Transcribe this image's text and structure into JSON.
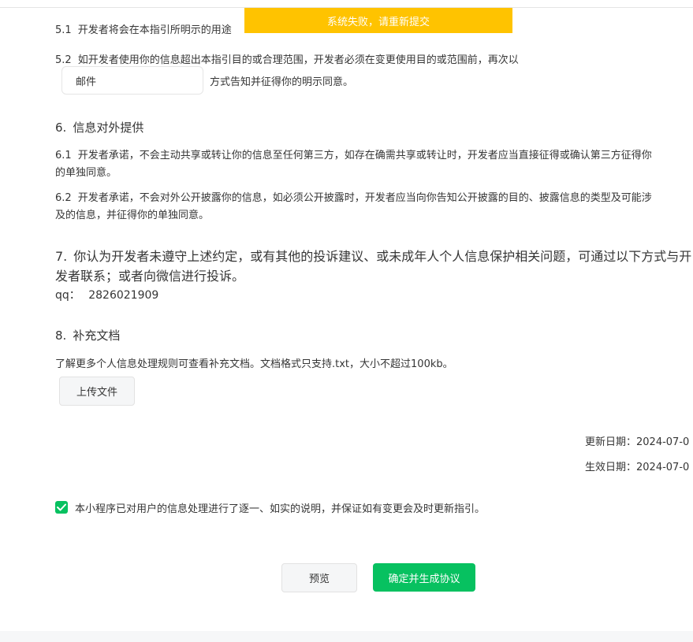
{
  "toast": {
    "text": "系统失败，请重新提交"
  },
  "section5": {
    "item1": {
      "num": "5.1",
      "text": "开发者将会在本指引所明示的用途"
    },
    "item2": {
      "num": "5.2",
      "text": "如开发者使用你的信息超出本指引目的或合理范围，开发者必须在变更使用目的或范围前，再次以"
    },
    "method_input_value": "邮件",
    "method_suffix": "方式告知并征得你的明示同意。"
  },
  "section6": {
    "heading_num": "6.",
    "heading": "信息对外提供",
    "item1": {
      "num": "6.1",
      "line1": "开发者承诺，不会主动共享或转让你的信息至任何第三方，如存在确需共享或转让时，开发者应当直接征得或确认第三方征得你",
      "line2": "的单独同意。"
    },
    "item2": {
      "num": "6.2",
      "line1": "开发者承诺，不会对外公开披露你的信息，如必须公开披露时，开发者应当向你告知公开披露的目的、披露信息的类型及可能涉",
      "line2": "及的信息，并征得你的单独同意。"
    }
  },
  "section7": {
    "heading_num": "7.",
    "line1": "你认为开发者未遵守上述约定，或有其他的投诉建议、或未成年人个人信息保护相关问题，可通过以下方式与开",
    "line2": "发者联系；或者向微信进行投诉。",
    "contact_label": "qq：",
    "contact_value": "2826021909"
  },
  "section8": {
    "heading_num": "8.",
    "heading": "补充文档",
    "description": "了解更多个人信息处理规则可查看补充文档。文档格式只支持.txt，大小不超过100kb。",
    "upload_label": "上传文件"
  },
  "dates": {
    "updated": "更新日期：2024-07-0",
    "effective": "生效日期：2024-07-0"
  },
  "agreement": {
    "checked": true,
    "text": "本小程序已对用户的信息处理进行了逐一、如实的说明，并保证如有变更会及时更新指引。"
  },
  "actions": {
    "preview_label": "预览",
    "confirm_label": "确定并生成协议"
  },
  "colors": {
    "accent_green": "#07c160",
    "toast_yellow": "#ffc300"
  }
}
